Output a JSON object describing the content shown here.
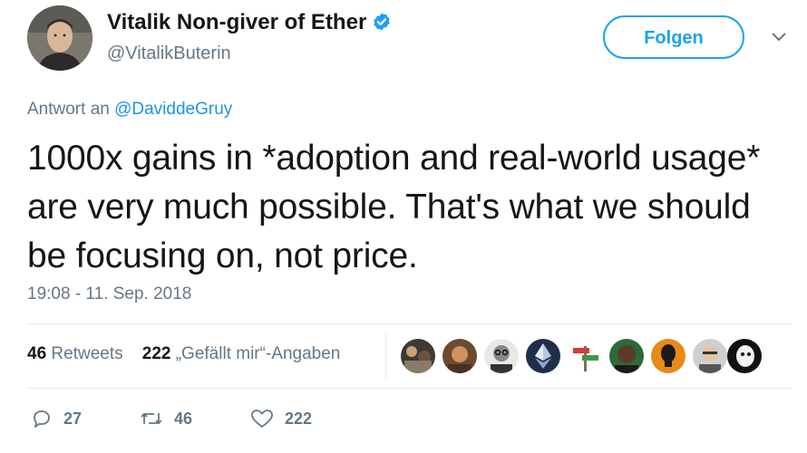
{
  "user": {
    "name": "Vitalik Non-giver of Ether",
    "handle": "@VitalikButerin",
    "verified": true,
    "follow_label": "Folgen"
  },
  "reply": {
    "prefix": "Antwort an",
    "handle": "@DaviddeGruy"
  },
  "tweet": {
    "text": "1000x gains in *adoption and real-world usage* are very much possible. That's what we should be focusing on, not price.",
    "timestamp": "19:08 - 11. Sep. 2018"
  },
  "stats": {
    "retweets_count": "46",
    "retweets_label": "Retweets",
    "likes_count": "222",
    "likes_label": "„Gefällt mir“-Angaben"
  },
  "likers": [
    "avatar-1",
    "avatar-2",
    "avatar-3",
    "ethereum-avatar",
    "signpost-avatar",
    "avatar-6",
    "lamp-avatar",
    "avatar-8",
    "avatar-9"
  ],
  "actions": {
    "replies": "27",
    "retweets": "46",
    "likes": "222"
  },
  "colors": {
    "accent": "#1da1f2",
    "link": "#1b95e0",
    "muted": "#657786",
    "text": "#14171a"
  }
}
